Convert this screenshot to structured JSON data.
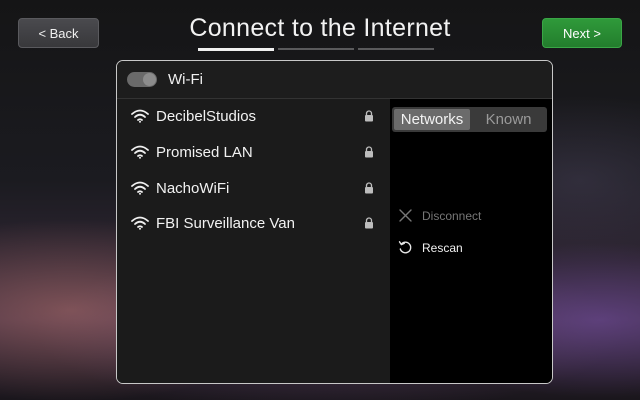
{
  "header": {
    "title": "Connect to the Internet",
    "back_label": "< Back",
    "next_label": "Next >",
    "progress": {
      "steps": 3,
      "current": 1
    }
  },
  "wifi": {
    "label": "Wi-Fi",
    "enabled": true
  },
  "networks": [
    {
      "name": "DecibelStudios",
      "icon": "wifi-icon",
      "secured": true
    },
    {
      "name": "Promised LAN",
      "icon": "wifi-icon",
      "secured": true
    },
    {
      "name": "NachoWiFi",
      "icon": "wifi-icon",
      "secured": true
    },
    {
      "name": "FBI Surveillance Van",
      "icon": "wifi-icon",
      "secured": true
    }
  ],
  "side_panel": {
    "tabs": [
      {
        "label": "Networks",
        "active": true
      },
      {
        "label": "Known",
        "active": false
      }
    ],
    "actions": [
      {
        "label": "Disconnect",
        "icon": "close-icon",
        "enabled": false
      },
      {
        "label": "Rescan",
        "icon": "refresh-icon",
        "enabled": true
      }
    ]
  },
  "colors": {
    "next_button": "#2a8d35",
    "panel_border": "#c8c8c8"
  }
}
